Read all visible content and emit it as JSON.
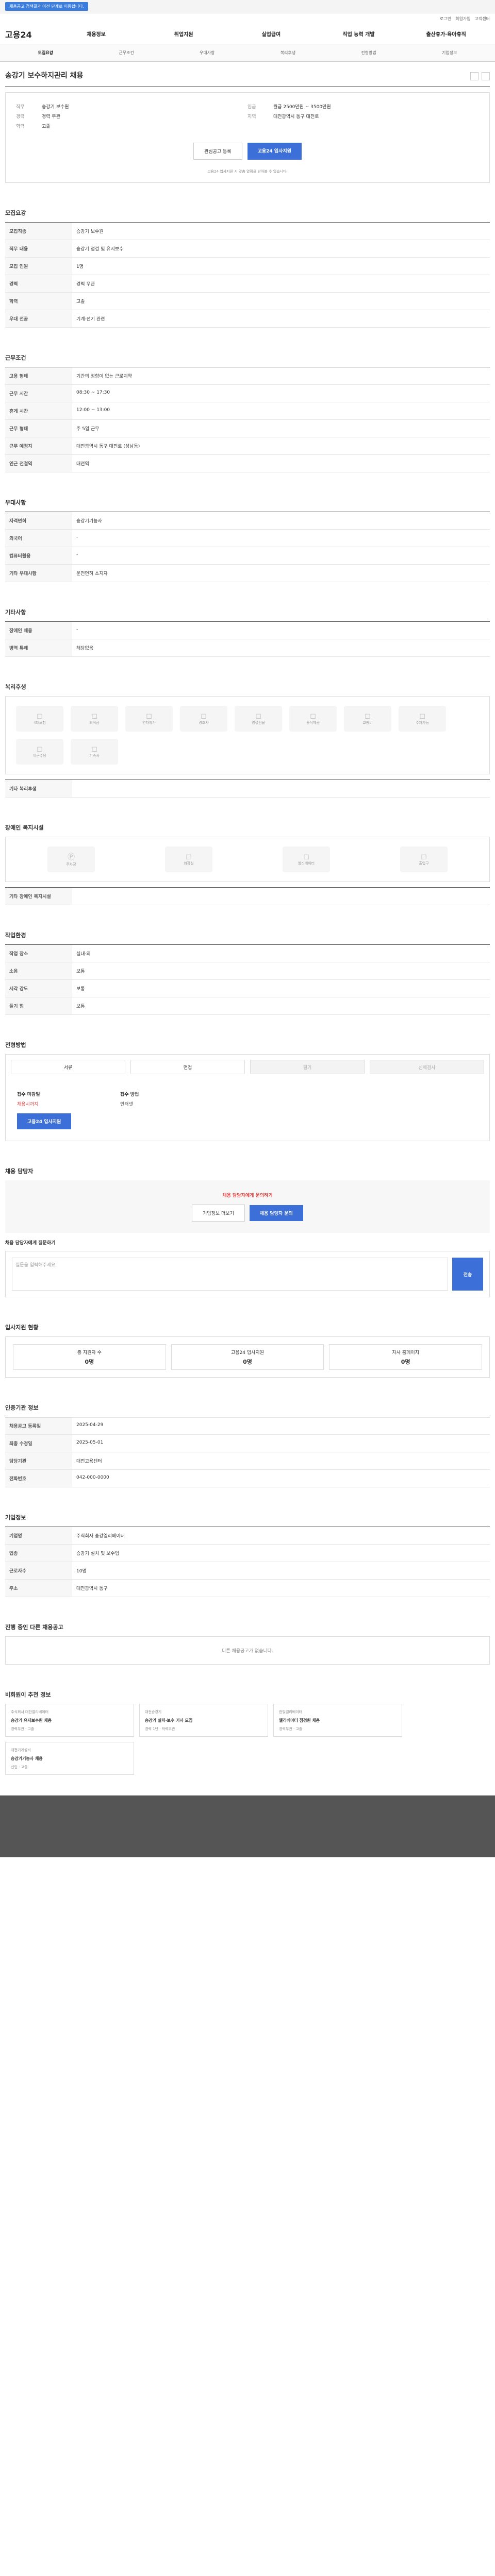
{
  "topbar": {
    "notice": "채용공고 검색결과 이전 단계로 이동합니다."
  },
  "util": [
    "로그인",
    "회원가입",
    "고객센터"
  ],
  "gnb": {
    "logo": "고용24",
    "menus": [
      "채용정보",
      "취업지원",
      "실업급여",
      "직업 능력 개발",
      "출산휴가·육아휴직"
    ]
  },
  "tabs": [
    "모집요강",
    "근무조건",
    "우대사항",
    "복리후생",
    "전형방법",
    "기업정보"
  ],
  "job": {
    "title": "송강기 보수하지관리 채용",
    "sum_left": [
      [
        "직무",
        "승강기 보수원"
      ],
      [
        "경력",
        "경력 무관"
      ],
      [
        "학력",
        "고졸"
      ]
    ],
    "sum_right": [
      [
        "임금",
        "월급 2500만원 ~ 3500만원"
      ],
      [
        "지역",
        "대전광역시 동구 대전로"
      ]
    ],
    "scrap": "관심공고 등록",
    "apply": "고용24 입사지원",
    "note": "고용24 입사지원 시 맞춤 알림을 받아볼 수 있습니다."
  },
  "recruit": {
    "title": "모집요강",
    "rows": [
      [
        "모집직종",
        "승강기 보수원"
      ],
      [
        "직무 내용",
        "승강기 점검 및 유지보수"
      ],
      [
        "모집 인원",
        "1명"
      ],
      [
        "경력",
        "경력 무관"
      ],
      [
        "학력",
        "고졸"
      ],
      [
        "우대 전공",
        "기계·전기 관련"
      ]
    ]
  },
  "work": {
    "title": "근무조건",
    "rows": [
      [
        "고용 형태",
        "기간의 정함이 없는 근로계약"
      ],
      [
        "근무 시간",
        "08:30 ~ 17:30"
      ],
      [
        "휴게 시간",
        "12:00 ~ 13:00"
      ],
      [
        "근무 형태",
        "주 5일 근무"
      ],
      [
        "근무 예정지",
        "대전광역시 동구 대전로 (성남동)"
      ],
      [
        "인근 전철역",
        "대전역"
      ]
    ]
  },
  "pref": {
    "title": "우대사항",
    "rows": [
      [
        "자격면허",
        "승강기기능사"
      ],
      [
        "외국어",
        "-"
      ],
      [
        "컴퓨터활용",
        "-"
      ],
      [
        "기타 우대사항",
        "운전면허 소지자"
      ]
    ]
  },
  "etc": {
    "title": "기타사항",
    "rows": [
      [
        "장애인 채용",
        "-"
      ],
      [
        "병역 특례",
        "해당없음"
      ]
    ]
  },
  "welfare": {
    "title": "복리후생",
    "icons": [
      "4대보험",
      "퇴직금",
      "연차휴가",
      "경조사",
      "명절선물",
      "중식제공",
      "교통비",
      "주차가능",
      "야근수당",
      "기숙사"
    ],
    "more": "기타 복리후생"
  },
  "disabled": {
    "title": "장애인 복지시설",
    "icons": [
      "주차장",
      "화장실",
      "엘리베이터",
      "출입구"
    ],
    "more": "기타 장애인 복지시설"
  },
  "env": {
    "title": "작업환경",
    "rows": [
      [
        "작업 장소",
        "실내·외"
      ],
      [
        "소음",
        "보통"
      ],
      [
        "시각 강도",
        "보통"
      ],
      [
        "들기 힘",
        "보통"
      ]
    ]
  },
  "method": {
    "title": "전형방법",
    "chips": [
      "서류",
      "면접",
      "필기",
      "신체검사"
    ]
  },
  "apply": {
    "period_k": "접수 마감일",
    "period_v": "채용시까지",
    "docs_k": "접수 방법",
    "docs_v": "인터넷",
    "btn": "고용24 입사지원"
  },
  "qa": {
    "title": "채용 담당자",
    "lead": "채용 담당자에게 문의하기",
    "btn1": "기업정보 더보기",
    "btn2": "채용 담당자 문의",
    "input_label": "채용 담당자에게 질문하기",
    "placeholder": "질문을 입력해주세요.",
    "send": "전송"
  },
  "stats": {
    "title": "입사지원 현황",
    "items": [
      [
        "총 지원자 수",
        "0명"
      ],
      [
        "고용24 입사지원",
        "0명"
      ],
      [
        "자사 홈페이지",
        "0명"
      ]
    ]
  },
  "agency": {
    "title": "인증기관 정보",
    "rows": [
      [
        "채용공고 등록일",
        "2025-04-29"
      ],
      [
        "최종 수정일",
        "2025-05-01"
      ],
      [
        "담당기관",
        "대전고용센터"
      ],
      [
        "전화번호",
        "042-000-0000"
      ]
    ]
  },
  "company": {
    "title": "기업정보",
    "rows": [
      [
        "기업명",
        "주식회사 송강엘리베이터"
      ],
      [
        "업종",
        "승강기 설치 및 보수업"
      ],
      [
        "근로자수",
        "10명"
      ],
      [
        "주소",
        "대전광역시 동구"
      ]
    ]
  },
  "related": {
    "title": "진행 중인 다른 채용공고",
    "empty": "다른 채용공고가 없습니다."
  },
  "recommend": {
    "title": "비회원이 추천 정보",
    "cards": [
      [
        "주식회사 대한엘리베이터",
        "승강기 유지보수원 채용",
        "경력무관 · 고졸"
      ],
      [
        "대전승강기",
        "승강기 설치·보수 기사 모집",
        "경력 1년 · 학력무관"
      ],
      [
        "한빛엘리베이터",
        "엘리베이터 점검원 채용",
        "경력무관 · 고졸"
      ],
      [
        "대전기계설비",
        "승강기기능사 채용",
        "신입 · 고졸"
      ]
    ]
  }
}
